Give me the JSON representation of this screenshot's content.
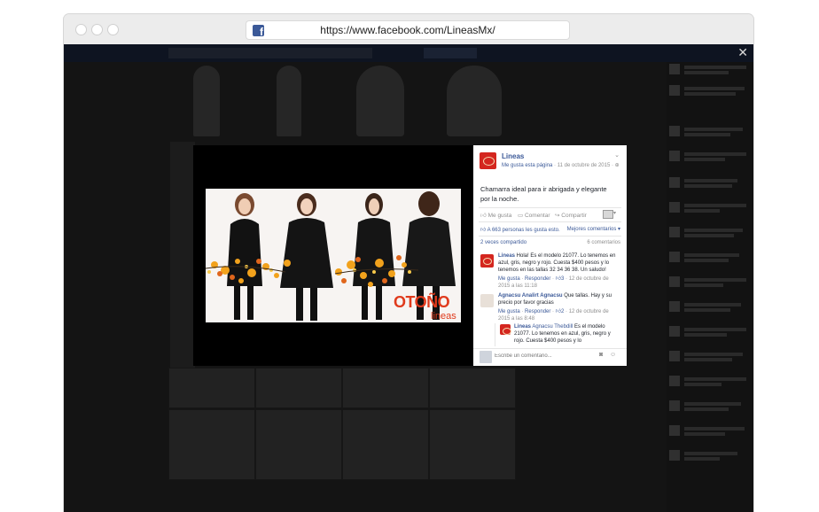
{
  "browser": {
    "url": "https://www.facebook.com/LineasMx/"
  },
  "photo": {
    "overlay_word": "OTOÑO",
    "overlay_brand": "lineas"
  },
  "post": {
    "page_name": "Lineas",
    "like_page": "Me gusta esta página",
    "date": " · 11 de octubre de 2015 · ",
    "caption": "Chamarra ideal para ir abrigada y elegante por la noche.",
    "actions": {
      "like": "Me gusta",
      "comment": "Comentar",
      "share": "Compartir"
    },
    "likes_text": "A 663 personas les gusta esto.",
    "best_comments": "Mejores comentarios ▾",
    "shares_text": "2 veces compartido",
    "comments_count": "6 comentarios"
  },
  "comments": [
    {
      "author": "Lineas",
      "text": " Hola! Es el modelo 21077. Lo tenemos en azul, gris, negro y rojo. Cuesta $400 pesos y lo tenemos en las tallas 32 34 36 38. Un saludo!",
      "like": "Me gusta",
      "reply": "Responder",
      "count": "3",
      "date": "12 de octubre de 2015 a las 11:18"
    },
    {
      "author": "Agnacsu Analirt Agnacsu",
      "text": " Que tallas. Hay y su precio por favor gracias",
      "like": "Me gusta",
      "reply": "Responder",
      "count": "2",
      "date": "12 de octubre de 2015 a las 8:48"
    },
    {
      "author": "Lineas",
      "mention": "Agnacsu Thebdill",
      "text": " Es el modelo 21077. Lo tenemos en azul, gris, negro y rojo. Cuesta $400 pesos y lo"
    }
  ],
  "comment_input": {
    "placeholder": "Escribe un comentario..."
  },
  "colors": {
    "facebook_blue": "#3b5998",
    "brand_red": "#d4261f",
    "overlay": "#141414"
  }
}
